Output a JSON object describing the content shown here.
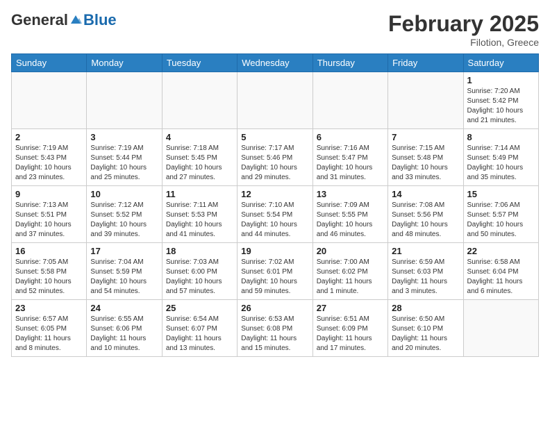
{
  "header": {
    "logo_general": "General",
    "logo_blue": "Blue",
    "month_title": "February 2025",
    "location": "Filotion, Greece"
  },
  "weekdays": [
    "Sunday",
    "Monday",
    "Tuesday",
    "Wednesday",
    "Thursday",
    "Friday",
    "Saturday"
  ],
  "weeks": [
    [
      {
        "day": "",
        "info": ""
      },
      {
        "day": "",
        "info": ""
      },
      {
        "day": "",
        "info": ""
      },
      {
        "day": "",
        "info": ""
      },
      {
        "day": "",
        "info": ""
      },
      {
        "day": "",
        "info": ""
      },
      {
        "day": "1",
        "info": "Sunrise: 7:20 AM\nSunset: 5:42 PM\nDaylight: 10 hours and 21 minutes."
      }
    ],
    [
      {
        "day": "2",
        "info": "Sunrise: 7:19 AM\nSunset: 5:43 PM\nDaylight: 10 hours and 23 minutes."
      },
      {
        "day": "3",
        "info": "Sunrise: 7:19 AM\nSunset: 5:44 PM\nDaylight: 10 hours and 25 minutes."
      },
      {
        "day": "4",
        "info": "Sunrise: 7:18 AM\nSunset: 5:45 PM\nDaylight: 10 hours and 27 minutes."
      },
      {
        "day": "5",
        "info": "Sunrise: 7:17 AM\nSunset: 5:46 PM\nDaylight: 10 hours and 29 minutes."
      },
      {
        "day": "6",
        "info": "Sunrise: 7:16 AM\nSunset: 5:47 PM\nDaylight: 10 hours and 31 minutes."
      },
      {
        "day": "7",
        "info": "Sunrise: 7:15 AM\nSunset: 5:48 PM\nDaylight: 10 hours and 33 minutes."
      },
      {
        "day": "8",
        "info": "Sunrise: 7:14 AM\nSunset: 5:49 PM\nDaylight: 10 hours and 35 minutes."
      }
    ],
    [
      {
        "day": "9",
        "info": "Sunrise: 7:13 AM\nSunset: 5:51 PM\nDaylight: 10 hours and 37 minutes."
      },
      {
        "day": "10",
        "info": "Sunrise: 7:12 AM\nSunset: 5:52 PM\nDaylight: 10 hours and 39 minutes."
      },
      {
        "day": "11",
        "info": "Sunrise: 7:11 AM\nSunset: 5:53 PM\nDaylight: 10 hours and 41 minutes."
      },
      {
        "day": "12",
        "info": "Sunrise: 7:10 AM\nSunset: 5:54 PM\nDaylight: 10 hours and 44 minutes."
      },
      {
        "day": "13",
        "info": "Sunrise: 7:09 AM\nSunset: 5:55 PM\nDaylight: 10 hours and 46 minutes."
      },
      {
        "day": "14",
        "info": "Sunrise: 7:08 AM\nSunset: 5:56 PM\nDaylight: 10 hours and 48 minutes."
      },
      {
        "day": "15",
        "info": "Sunrise: 7:06 AM\nSunset: 5:57 PM\nDaylight: 10 hours and 50 minutes."
      }
    ],
    [
      {
        "day": "16",
        "info": "Sunrise: 7:05 AM\nSunset: 5:58 PM\nDaylight: 10 hours and 52 minutes."
      },
      {
        "day": "17",
        "info": "Sunrise: 7:04 AM\nSunset: 5:59 PM\nDaylight: 10 hours and 54 minutes."
      },
      {
        "day": "18",
        "info": "Sunrise: 7:03 AM\nSunset: 6:00 PM\nDaylight: 10 hours and 57 minutes."
      },
      {
        "day": "19",
        "info": "Sunrise: 7:02 AM\nSunset: 6:01 PM\nDaylight: 10 hours and 59 minutes."
      },
      {
        "day": "20",
        "info": "Sunrise: 7:00 AM\nSunset: 6:02 PM\nDaylight: 11 hours and 1 minute."
      },
      {
        "day": "21",
        "info": "Sunrise: 6:59 AM\nSunset: 6:03 PM\nDaylight: 11 hours and 3 minutes."
      },
      {
        "day": "22",
        "info": "Sunrise: 6:58 AM\nSunset: 6:04 PM\nDaylight: 11 hours and 6 minutes."
      }
    ],
    [
      {
        "day": "23",
        "info": "Sunrise: 6:57 AM\nSunset: 6:05 PM\nDaylight: 11 hours and 8 minutes."
      },
      {
        "day": "24",
        "info": "Sunrise: 6:55 AM\nSunset: 6:06 PM\nDaylight: 11 hours and 10 minutes."
      },
      {
        "day": "25",
        "info": "Sunrise: 6:54 AM\nSunset: 6:07 PM\nDaylight: 11 hours and 13 minutes."
      },
      {
        "day": "26",
        "info": "Sunrise: 6:53 AM\nSunset: 6:08 PM\nDaylight: 11 hours and 15 minutes."
      },
      {
        "day": "27",
        "info": "Sunrise: 6:51 AM\nSunset: 6:09 PM\nDaylight: 11 hours and 17 minutes."
      },
      {
        "day": "28",
        "info": "Sunrise: 6:50 AM\nSunset: 6:10 PM\nDaylight: 11 hours and 20 minutes."
      },
      {
        "day": "",
        "info": ""
      }
    ]
  ]
}
